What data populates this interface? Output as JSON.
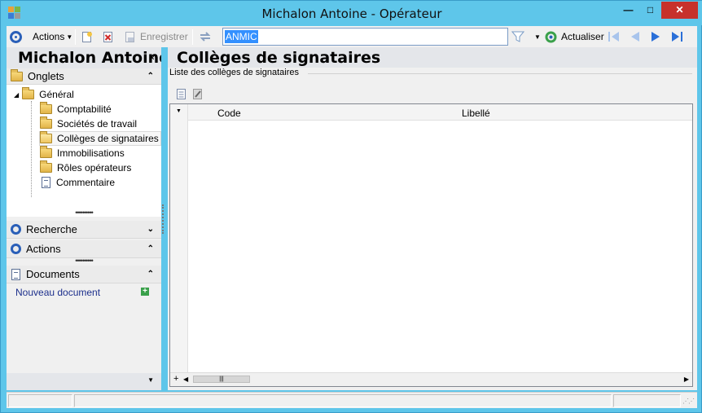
{
  "window": {
    "title": "Michalon Antoine -  Opérateur",
    "minimize": "—",
    "maximize": "□",
    "close": "✕"
  },
  "toolbar": {
    "actions_label": "Actions",
    "save_label": "Enregistrer",
    "search_value": "ANMIC",
    "refresh_label": "Actualiser"
  },
  "left_panel": {
    "header": "Michalon Antoine",
    "collapse_glyph": "«",
    "sections": {
      "onglets": "Onglets",
      "recherche": "Recherche",
      "actions": "Actions",
      "documents": "Documents"
    },
    "tree": {
      "root": "Général",
      "items": [
        "Comptabilité",
        "Sociétés de travail",
        "Collèges de signataires",
        "Immobilisations",
        "Rôles opérateurs",
        "Commentaire"
      ],
      "selected": "Collèges de signataires"
    },
    "new_document": "Nouveau document"
  },
  "main": {
    "title": "Collèges de signataires",
    "group_label": "Liste des collèges de signataires",
    "columns": [
      "Code",
      "Libellé"
    ],
    "rows": []
  },
  "colors": {
    "titlebar": "#5ec6ea",
    "close_button": "#c7312b",
    "accent_blue": "#2a5fb8",
    "selection": "#3390ff"
  }
}
